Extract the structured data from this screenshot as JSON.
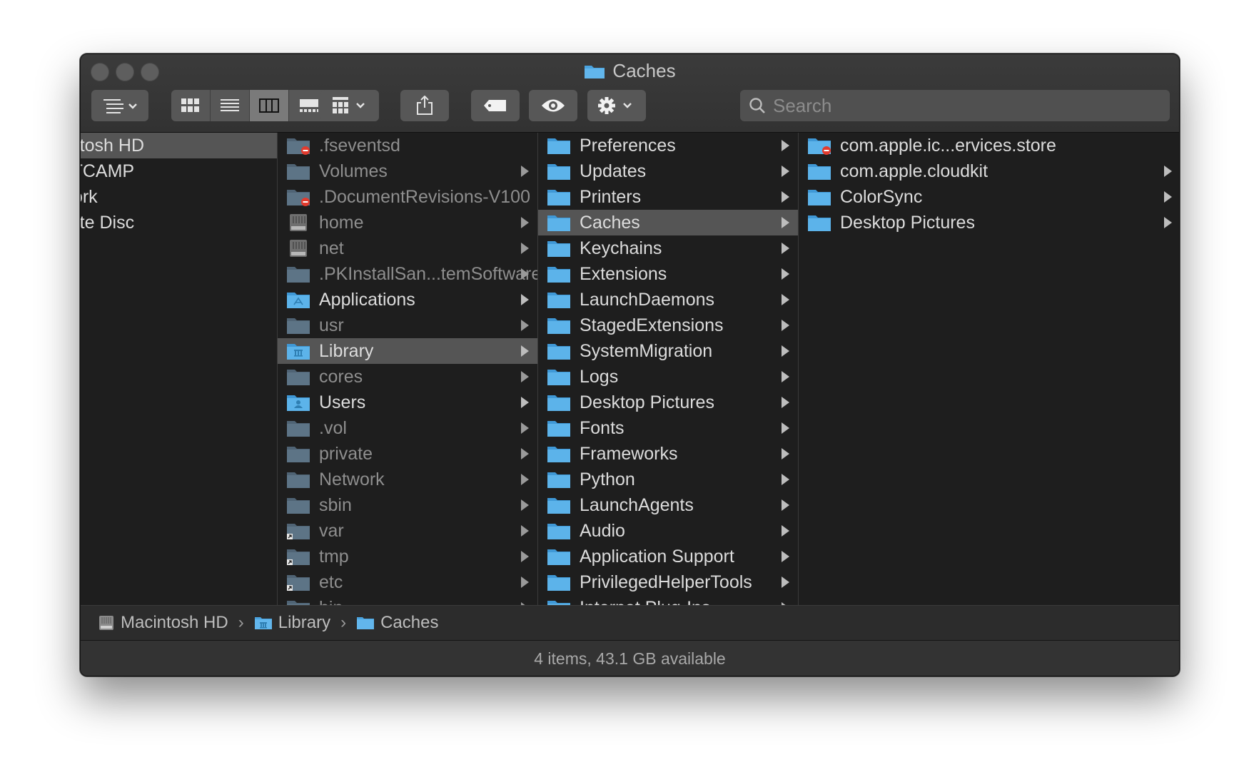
{
  "window": {
    "title": "Caches"
  },
  "toolbar": {
    "search_placeholder": "Search"
  },
  "columns": {
    "devices": [
      {
        "label": "Macintosh HD",
        "selected": true
      },
      {
        "label": "BOOTCAMP"
      },
      {
        "label": "Network"
      },
      {
        "label": "Remote Disc"
      }
    ],
    "root": [
      {
        "label": ".fseventsd",
        "icon": "restricted-folder-icon",
        "dim": true,
        "arrow": false
      },
      {
        "label": "Volumes",
        "icon": "folder-icon",
        "dim": true,
        "arrow": true
      },
      {
        "label": ".DocumentRevisions-V100",
        "icon": "restricted-folder-icon",
        "dim": true,
        "arrow": false
      },
      {
        "label": "home",
        "icon": "server-icon",
        "dim": true,
        "arrow": true
      },
      {
        "label": "net",
        "icon": "server-icon",
        "dim": true,
        "arrow": true
      },
      {
        "label": ".PKInstallSan...temSoftware",
        "icon": "folder-icon",
        "dim": true,
        "arrow": true
      },
      {
        "label": "Applications",
        "icon": "applications-folder-icon",
        "dim": false,
        "arrow": true
      },
      {
        "label": "usr",
        "icon": "folder-icon",
        "dim": true,
        "arrow": true
      },
      {
        "label": "Library",
        "icon": "library-folder-icon",
        "dim": false,
        "arrow": true,
        "selected": true
      },
      {
        "label": "cores",
        "icon": "folder-icon",
        "dim": true,
        "arrow": true
      },
      {
        "label": "Users",
        "icon": "users-folder-icon",
        "dim": false,
        "arrow": true
      },
      {
        "label": ".vol",
        "icon": "folder-icon",
        "dim": true,
        "arrow": true
      },
      {
        "label": "private",
        "icon": "folder-icon",
        "dim": true,
        "arrow": true
      },
      {
        "label": "Network",
        "icon": "folder-icon",
        "dim": true,
        "arrow": true
      },
      {
        "label": "sbin",
        "icon": "folder-icon",
        "dim": true,
        "arrow": true
      },
      {
        "label": "var",
        "icon": "alias-folder-icon",
        "dim": true,
        "arrow": true
      },
      {
        "label": "tmp",
        "icon": "alias-folder-icon",
        "dim": true,
        "arrow": true
      },
      {
        "label": "etc",
        "icon": "alias-folder-icon",
        "dim": true,
        "arrow": true
      },
      {
        "label": "bin",
        "icon": "folder-icon",
        "dim": true,
        "arrow": true
      }
    ],
    "library": [
      {
        "label": "Preferences"
      },
      {
        "label": "Updates"
      },
      {
        "label": "Printers"
      },
      {
        "label": "Caches",
        "selected": true
      },
      {
        "label": "Keychains"
      },
      {
        "label": "Extensions"
      },
      {
        "label": "LaunchDaemons"
      },
      {
        "label": "StagedExtensions"
      },
      {
        "label": "SystemMigration"
      },
      {
        "label": "Logs"
      },
      {
        "label": "Desktop Pictures"
      },
      {
        "label": "Fonts"
      },
      {
        "label": "Frameworks"
      },
      {
        "label": "Python"
      },
      {
        "label": "LaunchAgents"
      },
      {
        "label": "Audio"
      },
      {
        "label": "Application Support"
      },
      {
        "label": "PrivilegedHelperTools"
      },
      {
        "label": "Internet Plug-Ins"
      }
    ],
    "caches": [
      {
        "label": "com.apple.ic...ervices.store",
        "icon": "restricted-folder-icon",
        "arrow": false
      },
      {
        "label": "com.apple.cloudkit",
        "icon": "folder-icon",
        "arrow": true
      },
      {
        "label": "ColorSync",
        "icon": "folder-icon",
        "arrow": true
      },
      {
        "label": "Desktop Pictures",
        "icon": "folder-icon",
        "arrow": true
      }
    ]
  },
  "pathbar": {
    "items": [
      "Macintosh HD",
      "Library",
      "Caches"
    ]
  },
  "status": {
    "text": "4 items, 43.1 GB available"
  },
  "colors": {
    "folder_blue": "#4aa3df",
    "folder_grey": "#5a6a78",
    "selection": "#555555"
  }
}
